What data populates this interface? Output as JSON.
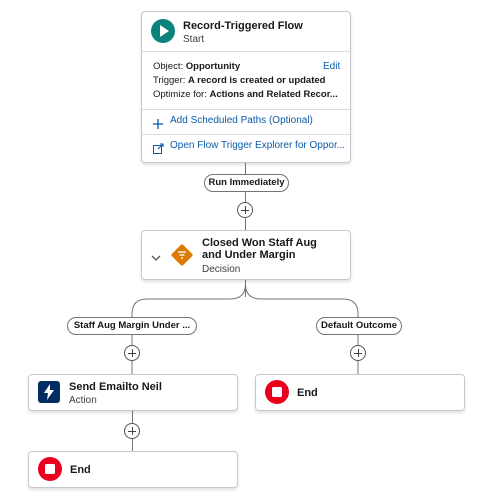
{
  "start": {
    "title": "Record-Triggered Flow",
    "subtitle": "Start",
    "object_label": "Object:",
    "object_value": "Opportunity",
    "edit_label": "Edit",
    "trigger_label": "Trigger:",
    "trigger_value": "A record is created or updated",
    "optimize_label": "Optimize for:",
    "optimize_value": "Actions and Related Recor...",
    "add_paths_label": "Add Scheduled Paths (Optional)",
    "explorer_label": "Open Flow Trigger Explorer for Oppor..."
  },
  "run_immediately_label": "Run Immediately",
  "decision": {
    "title": "Closed Won Staff Aug and Under Margin",
    "subtitle": "Decision"
  },
  "branches": {
    "left_label": "Staff Aug Margin Under ...",
    "right_label": "Default Outcome"
  },
  "action": {
    "title": "Send Emailto Neil",
    "subtitle": "Action"
  },
  "end_left": {
    "title": "End"
  },
  "end_right": {
    "title": "End"
  },
  "colors": {
    "start_icon": "#0b827c",
    "decision_icon": "#dd7a01",
    "action_icon": "#032d60",
    "end_icon": "#ea001e",
    "link": "#0b5cab"
  }
}
